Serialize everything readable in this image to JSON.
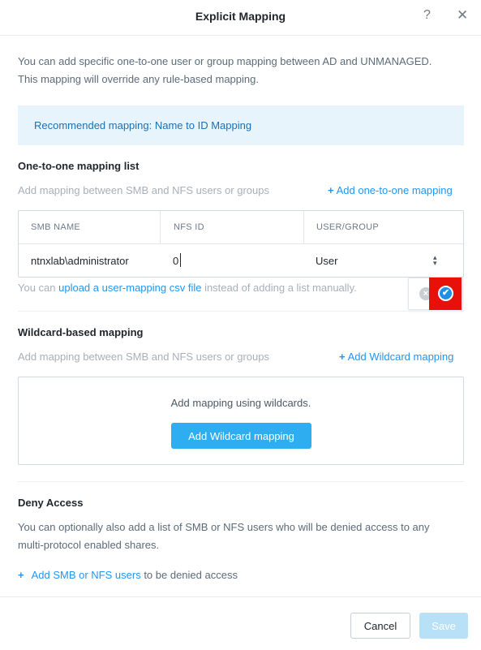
{
  "dialog": {
    "title": "Explicit Mapping",
    "help_glyph": "?",
    "close_glyph": "✕"
  },
  "intro": {
    "line1": "You can add specific one-to-one user or group mapping between AD and UNMANAGED.",
    "line2": "This mapping will override any rule-based mapping."
  },
  "recommendation": {
    "text": "Recommended mapping: Name to ID Mapping"
  },
  "one_to_one": {
    "title": "One-to-one mapping list",
    "description": "Add mapping between SMB and NFS users or groups",
    "add_link": "Add one-to-one mapping",
    "columns": [
      "SMB NAME",
      "NFS ID",
      "USER/GROUP"
    ],
    "row": {
      "smb_name": "ntnxlab\\administrator",
      "nfs_id": "0",
      "user_group": "User"
    },
    "csv_note_prefix": "You can ",
    "csv_link": "upload a user-mapping csv file",
    "csv_note_suffix": " instead of adding a list manually."
  },
  "wildcard": {
    "title": "Wildcard-based mapping",
    "description": "Add mapping between SMB and NFS users or groups",
    "add_link": "Add Wildcard mapping",
    "empty_text": "Add mapping using wildcards.",
    "button_label": "Add Wildcard mapping"
  },
  "deny": {
    "title": "Deny Access",
    "line1": "You can optionally also add a list of SMB or NFS users who will be denied access to any",
    "line2": "multi-protocol enabled shares.",
    "link": "Add SMB or NFS users",
    "link_suffix": " to be denied access"
  },
  "footer": {
    "cancel_label": "Cancel",
    "save_label": "Save"
  },
  "icons": {
    "plus": "+",
    "row_cancel": "×",
    "row_confirm": "✔",
    "select_arrows": "▲▼"
  },
  "colors": {
    "accent": "#2196f3",
    "highlight": "#e8100b",
    "save_disabled": "#b8e0f7"
  }
}
